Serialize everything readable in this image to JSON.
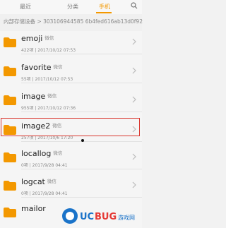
{
  "tabs": [
    {
      "label": "最近",
      "active": false
    },
    {
      "label": "分类",
      "active": false
    },
    {
      "label": "手机",
      "active": true
    }
  ],
  "accent_color": "#f39800",
  "highlight_color": "#d9372f",
  "breadcrumb": {
    "parts": [
      "内部存储设备",
      "303106944585 6b4fed616ab13d0f92"
    ],
    "separator": ">"
  },
  "folders": [
    {
      "name": "emoji",
      "tag": "微信",
      "meta": "422项 | 2017/10/12 07:53"
    },
    {
      "name": "favorite",
      "tag": "微信",
      "meta": "55项 | 2017/10/12 07:53"
    },
    {
      "name": "image",
      "tag": "微信",
      "meta": "955项 | 2017/10/12 07:36"
    },
    {
      "name": "image2",
      "tag": "微信",
      "meta": "257项 | 2017/10/6 17:20",
      "highlighted": true
    },
    {
      "name": "locallog",
      "tag": "微信",
      "meta": "0项 | 2017/9/28 04:41"
    },
    {
      "name": "logcat",
      "tag": "微信",
      "meta": "0项 | 2017/9/28 04:41"
    },
    {
      "name": "mailor",
      "tag": "",
      "meta": ""
    }
  ],
  "watermark": {
    "brand": "UCBUG",
    "suffix": "游戏网",
    "domain": ".com"
  }
}
